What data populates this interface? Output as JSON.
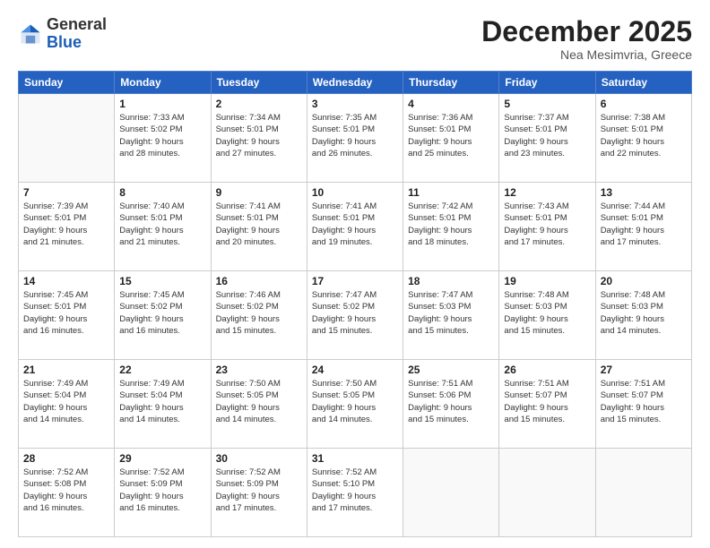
{
  "logo": {
    "general": "General",
    "blue": "Blue"
  },
  "title": "December 2025",
  "subtitle": "Nea Mesimvria, Greece",
  "days_of_week": [
    "Sunday",
    "Monday",
    "Tuesday",
    "Wednesday",
    "Thursday",
    "Friday",
    "Saturday"
  ],
  "weeks": [
    [
      {
        "day": "",
        "info": ""
      },
      {
        "day": "1",
        "info": "Sunrise: 7:33 AM\nSunset: 5:02 PM\nDaylight: 9 hours\nand 28 minutes."
      },
      {
        "day": "2",
        "info": "Sunrise: 7:34 AM\nSunset: 5:01 PM\nDaylight: 9 hours\nand 27 minutes."
      },
      {
        "day": "3",
        "info": "Sunrise: 7:35 AM\nSunset: 5:01 PM\nDaylight: 9 hours\nand 26 minutes."
      },
      {
        "day": "4",
        "info": "Sunrise: 7:36 AM\nSunset: 5:01 PM\nDaylight: 9 hours\nand 25 minutes."
      },
      {
        "day": "5",
        "info": "Sunrise: 7:37 AM\nSunset: 5:01 PM\nDaylight: 9 hours\nand 23 minutes."
      },
      {
        "day": "6",
        "info": "Sunrise: 7:38 AM\nSunset: 5:01 PM\nDaylight: 9 hours\nand 22 minutes."
      }
    ],
    [
      {
        "day": "7",
        "info": "Sunrise: 7:39 AM\nSunset: 5:01 PM\nDaylight: 9 hours\nand 21 minutes."
      },
      {
        "day": "8",
        "info": "Sunrise: 7:40 AM\nSunset: 5:01 PM\nDaylight: 9 hours\nand 21 minutes."
      },
      {
        "day": "9",
        "info": "Sunrise: 7:41 AM\nSunset: 5:01 PM\nDaylight: 9 hours\nand 20 minutes."
      },
      {
        "day": "10",
        "info": "Sunrise: 7:41 AM\nSunset: 5:01 PM\nDaylight: 9 hours\nand 19 minutes."
      },
      {
        "day": "11",
        "info": "Sunrise: 7:42 AM\nSunset: 5:01 PM\nDaylight: 9 hours\nand 18 minutes."
      },
      {
        "day": "12",
        "info": "Sunrise: 7:43 AM\nSunset: 5:01 PM\nDaylight: 9 hours\nand 17 minutes."
      },
      {
        "day": "13",
        "info": "Sunrise: 7:44 AM\nSunset: 5:01 PM\nDaylight: 9 hours\nand 17 minutes."
      }
    ],
    [
      {
        "day": "14",
        "info": "Sunrise: 7:45 AM\nSunset: 5:01 PM\nDaylight: 9 hours\nand 16 minutes."
      },
      {
        "day": "15",
        "info": "Sunrise: 7:45 AM\nSunset: 5:02 PM\nDaylight: 9 hours\nand 16 minutes."
      },
      {
        "day": "16",
        "info": "Sunrise: 7:46 AM\nSunset: 5:02 PM\nDaylight: 9 hours\nand 15 minutes."
      },
      {
        "day": "17",
        "info": "Sunrise: 7:47 AM\nSunset: 5:02 PM\nDaylight: 9 hours\nand 15 minutes."
      },
      {
        "day": "18",
        "info": "Sunrise: 7:47 AM\nSunset: 5:03 PM\nDaylight: 9 hours\nand 15 minutes."
      },
      {
        "day": "19",
        "info": "Sunrise: 7:48 AM\nSunset: 5:03 PM\nDaylight: 9 hours\nand 15 minutes."
      },
      {
        "day": "20",
        "info": "Sunrise: 7:48 AM\nSunset: 5:03 PM\nDaylight: 9 hours\nand 14 minutes."
      }
    ],
    [
      {
        "day": "21",
        "info": "Sunrise: 7:49 AM\nSunset: 5:04 PM\nDaylight: 9 hours\nand 14 minutes."
      },
      {
        "day": "22",
        "info": "Sunrise: 7:49 AM\nSunset: 5:04 PM\nDaylight: 9 hours\nand 14 minutes."
      },
      {
        "day": "23",
        "info": "Sunrise: 7:50 AM\nSunset: 5:05 PM\nDaylight: 9 hours\nand 14 minutes."
      },
      {
        "day": "24",
        "info": "Sunrise: 7:50 AM\nSunset: 5:05 PM\nDaylight: 9 hours\nand 14 minutes."
      },
      {
        "day": "25",
        "info": "Sunrise: 7:51 AM\nSunset: 5:06 PM\nDaylight: 9 hours\nand 15 minutes."
      },
      {
        "day": "26",
        "info": "Sunrise: 7:51 AM\nSunset: 5:07 PM\nDaylight: 9 hours\nand 15 minutes."
      },
      {
        "day": "27",
        "info": "Sunrise: 7:51 AM\nSunset: 5:07 PM\nDaylight: 9 hours\nand 15 minutes."
      }
    ],
    [
      {
        "day": "28",
        "info": "Sunrise: 7:52 AM\nSunset: 5:08 PM\nDaylight: 9 hours\nand 16 minutes."
      },
      {
        "day": "29",
        "info": "Sunrise: 7:52 AM\nSunset: 5:09 PM\nDaylight: 9 hours\nand 16 minutes."
      },
      {
        "day": "30",
        "info": "Sunrise: 7:52 AM\nSunset: 5:09 PM\nDaylight: 9 hours\nand 17 minutes."
      },
      {
        "day": "31",
        "info": "Sunrise: 7:52 AM\nSunset: 5:10 PM\nDaylight: 9 hours\nand 17 minutes."
      },
      {
        "day": "",
        "info": ""
      },
      {
        "day": "",
        "info": ""
      },
      {
        "day": "",
        "info": ""
      }
    ]
  ]
}
